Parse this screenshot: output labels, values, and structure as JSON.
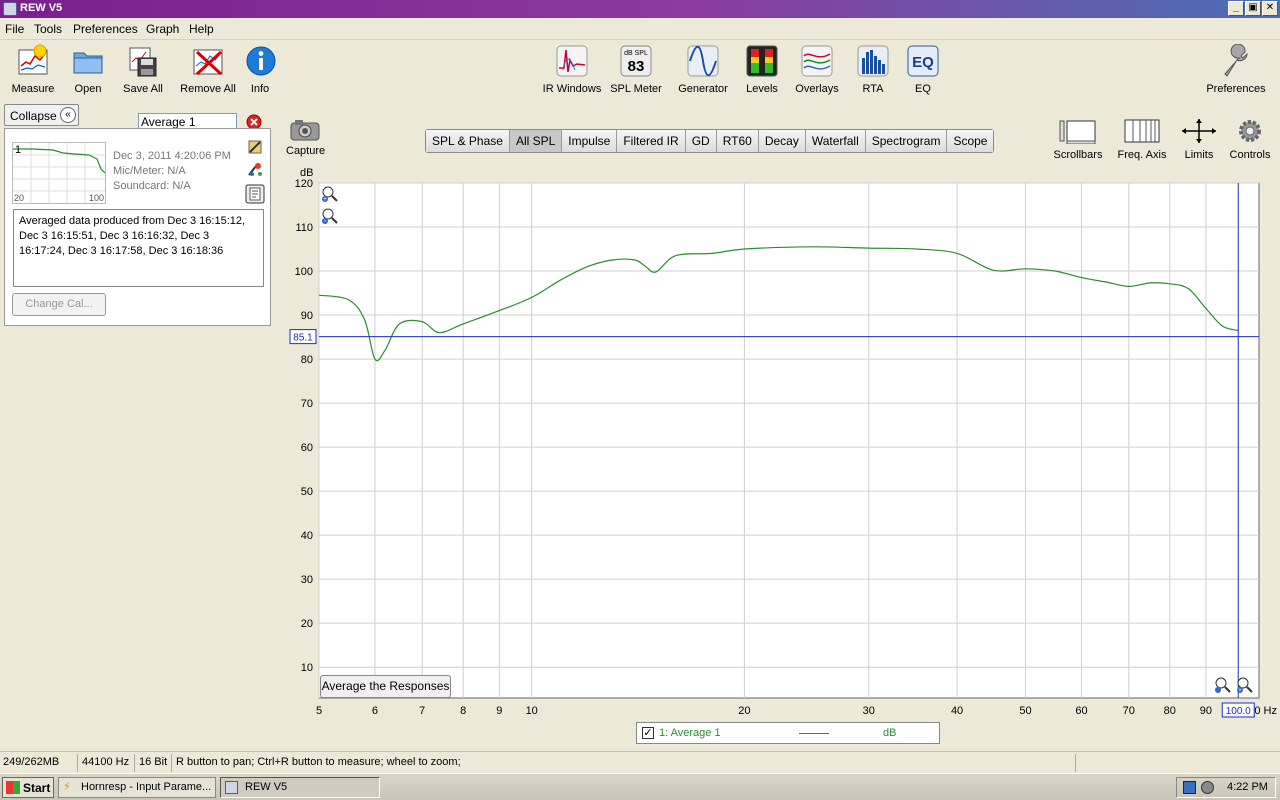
{
  "window": {
    "title": "REW V5",
    "controls": [
      "_",
      "▣",
      "✕"
    ]
  },
  "menu": [
    "File",
    "Tools",
    "Preferences",
    "Graph",
    "Help"
  ],
  "toolbar": {
    "left": [
      {
        "label": "Measure",
        "icon": "measure-icon"
      },
      {
        "label": "Open",
        "icon": "folder-icon"
      },
      {
        "label": "Save All",
        "icon": "save-icon"
      },
      {
        "label": "Remove All",
        "icon": "remove-icon"
      },
      {
        "label": "Info",
        "icon": "info-icon"
      }
    ],
    "center": [
      {
        "label": "IR Windows",
        "icon": "ir-windows-icon"
      },
      {
        "label": "SPL Meter",
        "icon": "spl-meter-icon",
        "top": "dB SPL",
        "value": "83"
      },
      {
        "label": "Generator",
        "icon": "generator-icon"
      },
      {
        "label": "Levels",
        "icon": "levels-icon"
      },
      {
        "label": "Overlays",
        "icon": "overlays-icon"
      },
      {
        "label": "RTA",
        "icon": "rta-icon"
      },
      {
        "label": "EQ",
        "icon": "eq-icon",
        "text": "EQ"
      }
    ],
    "right_label": "Preferences"
  },
  "measurement_panel": {
    "collapse_label": "Collapse",
    "name": "Average 1",
    "thumb_index": "1",
    "thumb_x_min": "20",
    "thumb_x_max": "100",
    "date": "Dec 3, 2011 4:20:06 PM",
    "mic": "Mic/Meter: N/A",
    "soundcard": "Soundcard: N/A",
    "notes": "Averaged data produced from Dec 3 16:15:12, Dec 3 16:15:51, Dec 3 16:16:32, Dec 3 16:17:24, Dec 3 16:17:58, Dec 3 16:18:36",
    "change_cal_label": "Change Cal..."
  },
  "graph_toolbar": {
    "capture_label": "Capture",
    "tabs": [
      "SPL & Phase",
      "All SPL",
      "Impulse",
      "Filtered IR",
      "GD",
      "RT60",
      "Decay",
      "Waterfall",
      "Spectrogram",
      "Scope"
    ],
    "selected_tab": "All SPL",
    "right_tools": [
      "Scrollbars",
      "Freq. Axis",
      "Limits",
      "Controls"
    ]
  },
  "chart_data": {
    "type": "line",
    "ylabel": "dB",
    "xlabel": "",
    "x_scale": "log",
    "xlim": [
      5,
      107
    ],
    "ylim": [
      3,
      120
    ],
    "y_ticks": [
      10,
      20,
      30,
      40,
      50,
      60,
      70,
      80,
      90,
      100,
      110,
      120
    ],
    "x_ticks": [
      5,
      6,
      7,
      8,
      9,
      10,
      20,
      30,
      40,
      50,
      60,
      70,
      80,
      90
    ],
    "x_unit_label": "10 Hz",
    "cursor": {
      "x": 100.0,
      "x_label": "100.0",
      "y": 85.1,
      "y_label": "85.1"
    },
    "grid": true,
    "series": [
      {
        "name": "1: Average 1",
        "color": "#2e8b2e",
        "x": [
          5,
          5.5,
          5.8,
          6.0,
          6.2,
          6.5,
          7.0,
          7.4,
          8.0,
          9.0,
          10,
          11,
          12,
          13,
          14,
          14.5,
          15,
          16,
          18,
          20,
          25,
          30,
          35,
          40,
          45,
          50,
          55,
          60,
          65,
          70,
          75,
          80,
          85,
          90,
          95,
          100
        ],
        "values": [
          94.5,
          93.5,
          89,
          80,
          82,
          88,
          88.5,
          86,
          88,
          91,
          94,
          98,
          101,
          102.5,
          102.5,
          101,
          99.8,
          103.5,
          104,
          105,
          105.5,
          105.2,
          105,
          104,
          100.2,
          100.5,
          100,
          98.5,
          97.5,
          96.5,
          97.3,
          97.1,
          96,
          91.5,
          87.5,
          86.5
        ]
      }
    ]
  },
  "zoom": {
    "in": "zoom-in-icon",
    "out": "zoom-out-icon"
  },
  "average_button": "Average the Responses",
  "legend": {
    "checked": true,
    "series": "1: Average 1",
    "unit": "dB"
  },
  "status": {
    "memory": "249/262MB",
    "rate": "44100 Hz",
    "bits": "16 Bit",
    "hint": "R button to pan; Ctrl+R button to measure; wheel to zoom;"
  },
  "taskbar": {
    "start": "Start",
    "tasks": [
      "Hornresp - Input Parame...",
      "REW V5"
    ],
    "time": "4:22 PM"
  }
}
